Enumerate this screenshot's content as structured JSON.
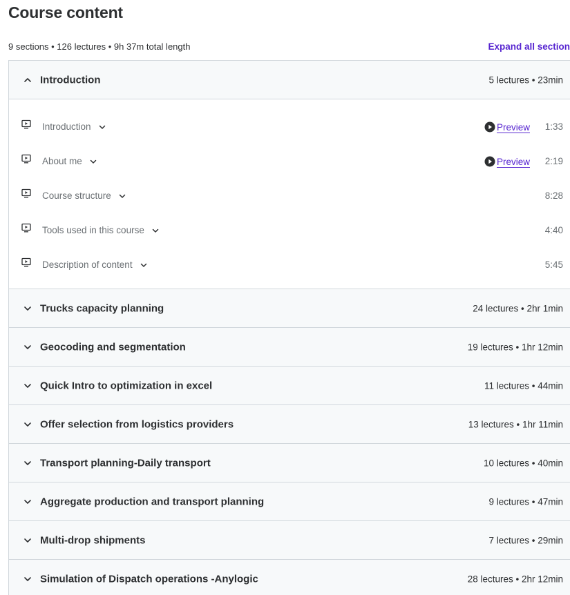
{
  "page_title": "Course content",
  "summary": "9 sections • 126 lectures • 9h 37m total length",
  "expand_all_label": "Expand all section",
  "sections": [
    {
      "title": "Introduction",
      "meta": "5 lectures • 23min",
      "expanded": true,
      "lectures": [
        {
          "title": "Introduction",
          "preview": "Preview",
          "duration": "1:33"
        },
        {
          "title": "About me",
          "preview": "Preview",
          "duration": "2:19"
        },
        {
          "title": "Course structure",
          "duration": "8:28"
        },
        {
          "title": "Tools used in this course",
          "duration": "4:40"
        },
        {
          "title": "Description of content",
          "duration": "5:45"
        }
      ]
    },
    {
      "title": "Trucks capacity planning",
      "meta": "24 lectures • 2hr 1min"
    },
    {
      "title": "Geocoding and segmentation",
      "meta": "19 lectures • 1hr 12min"
    },
    {
      "title": "Quick Intro to optimization in excel",
      "meta": "11 lectures • 44min"
    },
    {
      "title": "Offer selection from logistics providers",
      "meta": "13 lectures • 1hr 11min"
    },
    {
      "title": "Transport planning-Daily transport",
      "meta": "10 lectures • 40min"
    },
    {
      "title": "Aggregate production and transport planning",
      "meta": "9 lectures • 47min"
    },
    {
      "title": "Multi-drop shipments",
      "meta": "7 lectures • 29min"
    },
    {
      "title": "Simulation of Dispatch operations -Anylogic",
      "meta": "28 lectures • 2hr 12min"
    }
  ],
  "icons": {
    "expanded": "chevron-up-icon",
    "collapsed": "chevron-down-icon",
    "lecture": "video-icon",
    "preview": "play-circle-icon"
  },
  "colors": {
    "accent": "#5624d0",
    "text": "#2d2f31",
    "muted": "#6a6f73",
    "border": "#d1d7dc",
    "header_bg": "#f7f9fa"
  }
}
